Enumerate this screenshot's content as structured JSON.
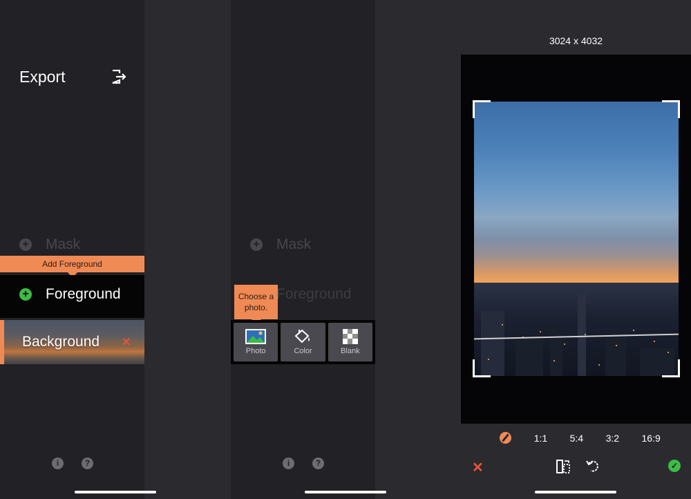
{
  "screen1": {
    "title": "Export",
    "icons": {
      "export": "export-icon",
      "info": "info-icon",
      "help": "help-icon"
    },
    "layers": {
      "mask": "Mask",
      "foreground": "Foreground",
      "background": "Background"
    },
    "tooltip": "Add Foreground",
    "colors": {
      "accent": "#f08a55",
      "add": "#3cbc46",
      "remove": "#e8553a"
    }
  },
  "screen2": {
    "layers": {
      "mask": "Mask",
      "foreground": "Foreground"
    },
    "tooltip": "Choose a photo.",
    "sources": [
      {
        "label": "Photo",
        "icon": "photo-icon"
      },
      {
        "label": "Color",
        "icon": "paint-bucket-icon"
      },
      {
        "label": "Blank",
        "icon": "checkerboard-icon"
      }
    ]
  },
  "screen3": {
    "resolution": "3024 x 4032",
    "ratios": [
      "1:1",
      "5:4",
      "3:2",
      "16:9"
    ],
    "icons": {
      "free": "free-ratio-icon",
      "cancel": "cancel-icon",
      "flip": "flip-icon",
      "rotate": "rotate-icon",
      "confirm": "confirm-icon"
    }
  }
}
